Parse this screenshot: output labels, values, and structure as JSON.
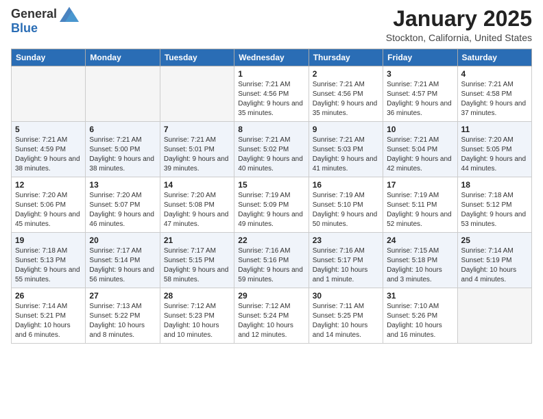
{
  "header": {
    "logo_general": "General",
    "logo_blue": "Blue",
    "title": "January 2025",
    "location": "Stockton, California, United States"
  },
  "days_of_week": [
    "Sunday",
    "Monday",
    "Tuesday",
    "Wednesday",
    "Thursday",
    "Friday",
    "Saturday"
  ],
  "weeks": [
    {
      "days": [
        {
          "number": "",
          "empty": true
        },
        {
          "number": "",
          "empty": true
        },
        {
          "number": "",
          "empty": true
        },
        {
          "number": "1",
          "sunrise": "7:21 AM",
          "sunset": "4:56 PM",
          "daylight": "9 hours and 35 minutes."
        },
        {
          "number": "2",
          "sunrise": "7:21 AM",
          "sunset": "4:56 PM",
          "daylight": "9 hours and 35 minutes."
        },
        {
          "number": "3",
          "sunrise": "7:21 AM",
          "sunset": "4:57 PM",
          "daylight": "9 hours and 36 minutes."
        },
        {
          "number": "4",
          "sunrise": "7:21 AM",
          "sunset": "4:58 PM",
          "daylight": "9 hours and 37 minutes."
        }
      ]
    },
    {
      "days": [
        {
          "number": "5",
          "sunrise": "7:21 AM",
          "sunset": "4:59 PM",
          "daylight": "9 hours and 38 minutes."
        },
        {
          "number": "6",
          "sunrise": "7:21 AM",
          "sunset": "5:00 PM",
          "daylight": "9 hours and 38 minutes."
        },
        {
          "number": "7",
          "sunrise": "7:21 AM",
          "sunset": "5:01 PM",
          "daylight": "9 hours and 39 minutes."
        },
        {
          "number": "8",
          "sunrise": "7:21 AM",
          "sunset": "5:02 PM",
          "daylight": "9 hours and 40 minutes."
        },
        {
          "number": "9",
          "sunrise": "7:21 AM",
          "sunset": "5:03 PM",
          "daylight": "9 hours and 41 minutes."
        },
        {
          "number": "10",
          "sunrise": "7:21 AM",
          "sunset": "5:04 PM",
          "daylight": "9 hours and 42 minutes."
        },
        {
          "number": "11",
          "sunrise": "7:20 AM",
          "sunset": "5:05 PM",
          "daylight": "9 hours and 44 minutes."
        }
      ]
    },
    {
      "days": [
        {
          "number": "12",
          "sunrise": "7:20 AM",
          "sunset": "5:06 PM",
          "daylight": "9 hours and 45 minutes."
        },
        {
          "number": "13",
          "sunrise": "7:20 AM",
          "sunset": "5:07 PM",
          "daylight": "9 hours and 46 minutes."
        },
        {
          "number": "14",
          "sunrise": "7:20 AM",
          "sunset": "5:08 PM",
          "daylight": "9 hours and 47 minutes."
        },
        {
          "number": "15",
          "sunrise": "7:19 AM",
          "sunset": "5:09 PM",
          "daylight": "9 hours and 49 minutes."
        },
        {
          "number": "16",
          "sunrise": "7:19 AM",
          "sunset": "5:10 PM",
          "daylight": "9 hours and 50 minutes."
        },
        {
          "number": "17",
          "sunrise": "7:19 AM",
          "sunset": "5:11 PM",
          "daylight": "9 hours and 52 minutes."
        },
        {
          "number": "18",
          "sunrise": "7:18 AM",
          "sunset": "5:12 PM",
          "daylight": "9 hours and 53 minutes."
        }
      ]
    },
    {
      "days": [
        {
          "number": "19",
          "sunrise": "7:18 AM",
          "sunset": "5:13 PM",
          "daylight": "9 hours and 55 minutes."
        },
        {
          "number": "20",
          "sunrise": "7:17 AM",
          "sunset": "5:14 PM",
          "daylight": "9 hours and 56 minutes."
        },
        {
          "number": "21",
          "sunrise": "7:17 AM",
          "sunset": "5:15 PM",
          "daylight": "9 hours and 58 minutes."
        },
        {
          "number": "22",
          "sunrise": "7:16 AM",
          "sunset": "5:16 PM",
          "daylight": "9 hours and 59 minutes."
        },
        {
          "number": "23",
          "sunrise": "7:16 AM",
          "sunset": "5:17 PM",
          "daylight": "10 hours and 1 minute."
        },
        {
          "number": "24",
          "sunrise": "7:15 AM",
          "sunset": "5:18 PM",
          "daylight": "10 hours and 3 minutes."
        },
        {
          "number": "25",
          "sunrise": "7:14 AM",
          "sunset": "5:19 PM",
          "daylight": "10 hours and 4 minutes."
        }
      ]
    },
    {
      "days": [
        {
          "number": "26",
          "sunrise": "7:14 AM",
          "sunset": "5:21 PM",
          "daylight": "10 hours and 6 minutes."
        },
        {
          "number": "27",
          "sunrise": "7:13 AM",
          "sunset": "5:22 PM",
          "daylight": "10 hours and 8 minutes."
        },
        {
          "number": "28",
          "sunrise": "7:12 AM",
          "sunset": "5:23 PM",
          "daylight": "10 hours and 10 minutes."
        },
        {
          "number": "29",
          "sunrise": "7:12 AM",
          "sunset": "5:24 PM",
          "daylight": "10 hours and 12 minutes."
        },
        {
          "number": "30",
          "sunrise": "7:11 AM",
          "sunset": "5:25 PM",
          "daylight": "10 hours and 14 minutes."
        },
        {
          "number": "31",
          "sunrise": "7:10 AM",
          "sunset": "5:26 PM",
          "daylight": "10 hours and 16 minutes."
        },
        {
          "number": "",
          "empty": true
        }
      ]
    }
  ]
}
